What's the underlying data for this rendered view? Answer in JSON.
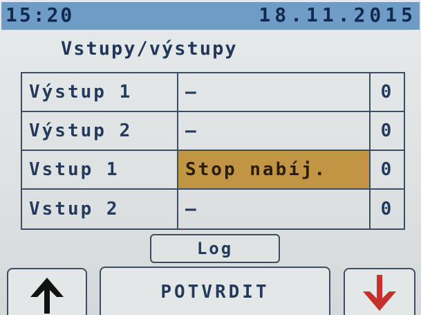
{
  "status_bar": {
    "time": "15:20",
    "date": "18.11.2015"
  },
  "screen_title": "Vstupy/výstupy",
  "io_rows": [
    {
      "name": "Výstup 1",
      "state": "–",
      "value": "0",
      "active": false
    },
    {
      "name": "Výstup 2",
      "state": "–",
      "value": "0",
      "active": false
    },
    {
      "name": "Vstup 1",
      "state": "Stop nabíj.",
      "value": "0",
      "active": true
    },
    {
      "name": "Vstup 2",
      "state": "–",
      "value": "0",
      "active": false
    }
  ],
  "buttons": {
    "log_label": "Log",
    "confirm_label": "POTVRDIT",
    "up_icon": "arrow-up-icon",
    "down_icon": "arrow-down-icon"
  },
  "colors": {
    "status_bar_bg": "#6f9bc7",
    "active_cell_bg": "#c29544",
    "up_arrow": "#111111",
    "down_arrow": "#c8302c"
  }
}
